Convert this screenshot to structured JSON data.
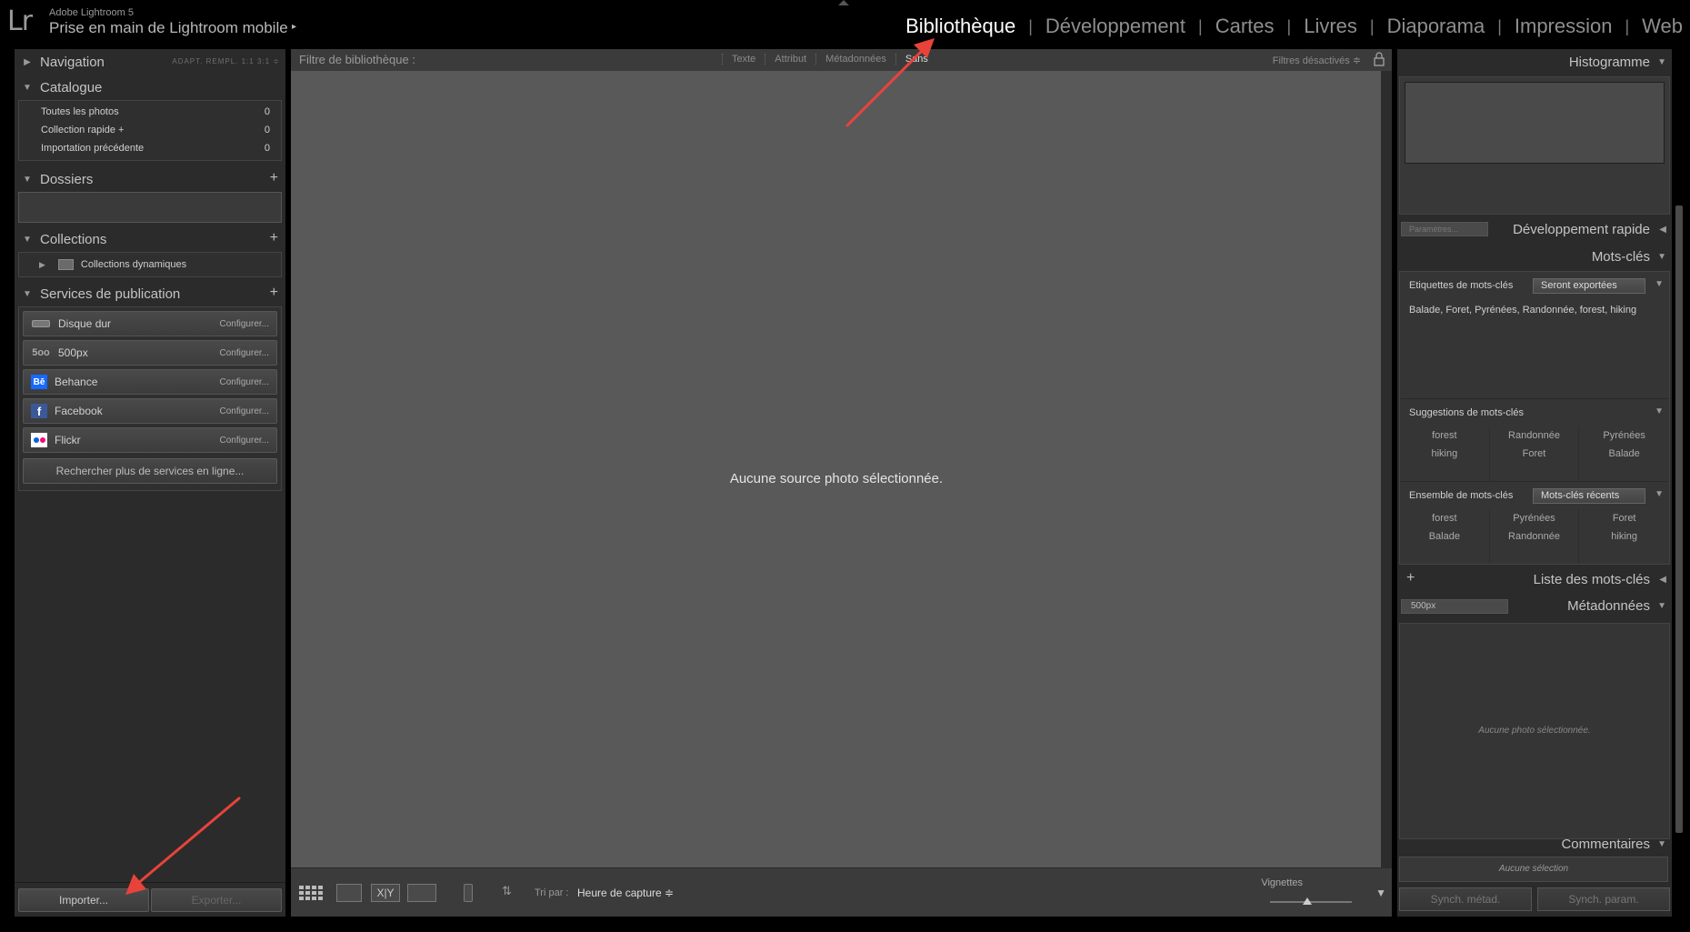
{
  "app": {
    "logo": "Lr",
    "name": "Adobe Lightroom 5",
    "catalog": "Prise en main de Lightroom mobile",
    "catalog_arrow": "▸"
  },
  "modules": [
    {
      "label": "Bibliothèque",
      "active": true
    },
    {
      "label": "Développement"
    },
    {
      "label": "Cartes"
    },
    {
      "label": "Livres"
    },
    {
      "label": "Diaporama"
    },
    {
      "label": "Impression"
    },
    {
      "label": "Web"
    }
  ],
  "left": {
    "navigation": {
      "title": "Navigation",
      "options": "ADAPT.  REMPL.  1:1  3:1 ≑"
    },
    "catalogue": {
      "title": "Catalogue",
      "rows": [
        {
          "label": "Toutes les photos",
          "count": "0"
        },
        {
          "label": "Collection rapide +",
          "count": "0"
        },
        {
          "label": "Importation précédente",
          "count": "0"
        }
      ]
    },
    "dossiers": {
      "title": "Dossiers"
    },
    "collections": {
      "title": "Collections",
      "item": "Collections dynamiques"
    },
    "publication": {
      "title": "Services de publication",
      "services": [
        {
          "name": "Disque dur",
          "icon": "hard-drive-icon",
          "action": "Configurer..."
        },
        {
          "name": "500px",
          "icon": "500px-icon",
          "action": "Configurer..."
        },
        {
          "name": "Behance",
          "icon": "behance-icon",
          "action": "Configurer..."
        },
        {
          "name": "Facebook",
          "icon": "facebook-icon",
          "action": "Configurer..."
        },
        {
          "name": "Flickr",
          "icon": "flickr-icon",
          "action": "Configurer..."
        }
      ],
      "search_more": "Rechercher plus de services en ligne..."
    },
    "import_label": "Importer...",
    "export_label": "Exporter..."
  },
  "center": {
    "filter_label": "Filtre de bibliothèque :",
    "filter_options": [
      "Texte",
      "Attribut",
      "Métadonnées",
      "Sans"
    ],
    "filter_active": "Sans",
    "filters_off": "Filtres désactivés ≑",
    "empty_message": "Aucune source photo sélectionnée.",
    "sort_label": "Tri par :",
    "sort_value": "Heure de capture ≑",
    "thumbnails_label": "Vignettes",
    "thumbnail_size": 0.45
  },
  "right": {
    "histogram": "Histogramme",
    "params": "Paramètres...",
    "quick_develop": "Développement rapide",
    "keywords": "Mots-clés",
    "keyword_tags_label": "Etiquettes de mots-clés",
    "keyword_tags_select": "Seront exportées",
    "keyword_tags_text": "Balade, Foret, Pyrénées, Randonnée, forest, hiking",
    "suggestions_label": "Suggestions de mots-clés",
    "suggestions": [
      "forest",
      "Randonnée",
      "Pyrénées",
      "hiking",
      "Foret",
      "Balade",
      "",
      "",
      ""
    ],
    "keyword_set_label": "Ensemble de mots-clés",
    "keyword_set_select": "Mots-clés récents",
    "keyword_set": [
      "forest",
      "Pyrénées",
      "Foret",
      "Balade",
      "Randonnée",
      "hiking",
      "",
      "",
      ""
    ],
    "keyword_list": "Liste des mots-clés",
    "metadata_select": "500px",
    "metadata": "Métadonnées",
    "metadata_empty": "Aucune photo sélectionnée.",
    "comments": "Commentaires",
    "no_selection": "Aucune sélection",
    "sync_meta": "Synch. métad.",
    "sync_params": "Synch. param."
  },
  "colors": {
    "annotation_arrow": "#e8433a",
    "active_module": "#ffffff"
  }
}
